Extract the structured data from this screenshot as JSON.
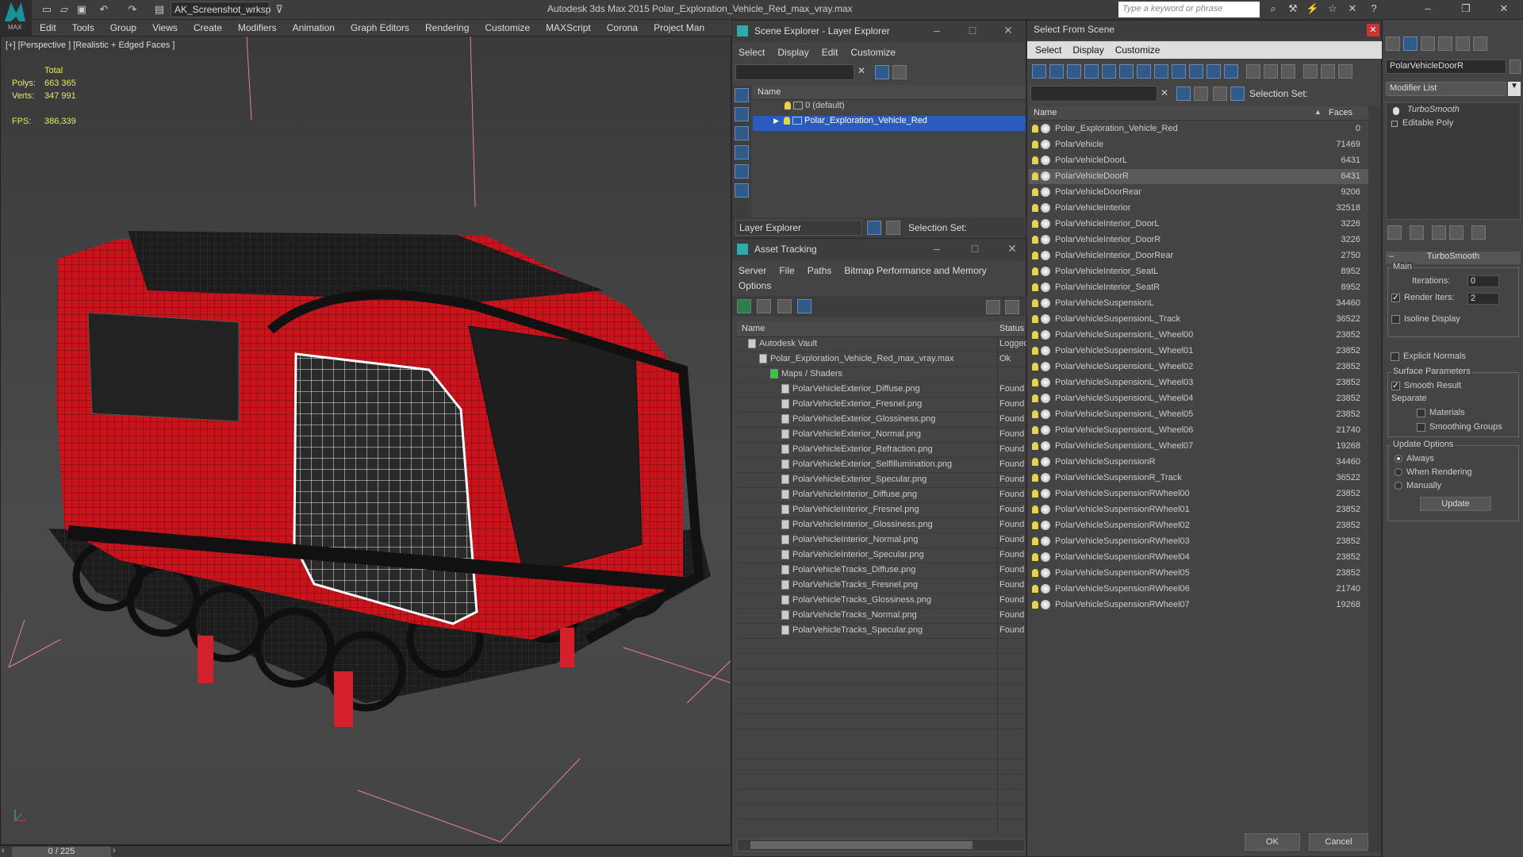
{
  "app": {
    "title": "Autodesk 3ds Max  2015    Polar_Exploration_Vehicle_Red_max_vray.max",
    "workspace": "AK_Screenshot_wrksp",
    "search_placeholder": "Type a keyword or phrase",
    "logo_text": "MAX"
  },
  "menubar": [
    "Edit",
    "Tools",
    "Group",
    "Views",
    "Create",
    "Modifiers",
    "Animation",
    "Graph Editors",
    "Rendering",
    "Customize",
    "MAXScript",
    "Corona",
    "Project Man"
  ],
  "viewport": {
    "label": "[+] [Perspective ] [Realistic + Edged Faces ]",
    "stats": {
      "total_label": "Total",
      "polys_label": "Polys:",
      "polys": "663 365",
      "verts_label": "Verts:",
      "verts": "347 991",
      "fps_label": "FPS:",
      "fps": "386,339"
    },
    "timeline": "0 / 225"
  },
  "scene_explorer": {
    "title": "Scene Explorer - Layer Explorer",
    "menu": [
      "Select",
      "Display",
      "Edit",
      "Customize"
    ],
    "col_name": "Name",
    "layers": [
      "0 (default)",
      "Polar_Exploration_Vehicle_Red"
    ],
    "footer_label": "Layer Explorer",
    "selection_set": "Selection Set:"
  },
  "asset_tracking": {
    "title": "Asset Tracking",
    "menu": [
      "Server",
      "File",
      "Paths",
      "Bitmap Performance and Memory"
    ],
    "menu2": "Options",
    "col_name": "Name",
    "col_status": "Status",
    "rows": [
      {
        "name": "Autodesk Vault",
        "status": "Logged",
        "indent": 1
      },
      {
        "name": "Polar_Exploration_Vehicle_Red_max_vray.max",
        "status": "Ok",
        "indent": 2
      },
      {
        "name": "Maps / Shaders",
        "status": "",
        "indent": 3
      },
      {
        "name": "PolarVehicleExterior_Diffuse.png",
        "status": "Found",
        "indent": 4
      },
      {
        "name": "PolarVehicleExterior_Fresnel.png",
        "status": "Found",
        "indent": 4
      },
      {
        "name": "PolarVehicleExterior_Glossiness.png",
        "status": "Found",
        "indent": 4
      },
      {
        "name": "PolarVehicleExterior_Normal.png",
        "status": "Found",
        "indent": 4
      },
      {
        "name": "PolarVehicleExterior_Refraction.png",
        "status": "Found",
        "indent": 4
      },
      {
        "name": "PolarVehicleExterior_SelfIllumination.png",
        "status": "Found",
        "indent": 4
      },
      {
        "name": "PolarVehicleExterior_Specular.png",
        "status": "Found",
        "indent": 4
      },
      {
        "name": "PolarVehicleInterior_Diffuse.png",
        "status": "Found",
        "indent": 4
      },
      {
        "name": "PolarVehicleInterior_Fresnel.png",
        "status": "Found",
        "indent": 4
      },
      {
        "name": "PolarVehicleInterior_Glossiness.png",
        "status": "Found",
        "indent": 4
      },
      {
        "name": "PolarVehicleInterior_Normal.png",
        "status": "Found",
        "indent": 4
      },
      {
        "name": "PolarVehicleInterior_Specular.png",
        "status": "Found",
        "indent": 4
      },
      {
        "name": "PolarVehicleTracks_Diffuse.png",
        "status": "Found",
        "indent": 4
      },
      {
        "name": "PolarVehicleTracks_Fresnel.png",
        "status": "Found",
        "indent": 4
      },
      {
        "name": "PolarVehicleTracks_Glossiness.png",
        "status": "Found",
        "indent": 4
      },
      {
        "name": "PolarVehicleTracks_Normal.png",
        "status": "Found",
        "indent": 4
      },
      {
        "name": "PolarVehicleTracks_Specular.png",
        "status": "Found",
        "indent": 4
      }
    ]
  },
  "select_from_scene": {
    "title": "Select From Scene",
    "menu": [
      "Select",
      "Display",
      "Customize"
    ],
    "selection_set": "Selection Set:",
    "col_name": "Name",
    "col_faces": "Faces",
    "ok": "OK",
    "cancel": "Cancel",
    "rows": [
      {
        "name": "Polar_Exploration_Vehicle_Red",
        "faces": "0"
      },
      {
        "name": "PolarVehicle",
        "faces": "71469"
      },
      {
        "name": "PolarVehicleDoorL",
        "faces": "6431"
      },
      {
        "name": "PolarVehicleDoorR",
        "faces": "6431"
      },
      {
        "name": "PolarVehicleDoorRear",
        "faces": "9206"
      },
      {
        "name": "PolarVehicleInterior",
        "faces": "32518"
      },
      {
        "name": "PolarVehicleInterior_DoorL",
        "faces": "3226"
      },
      {
        "name": "PolarVehicleInterior_DoorR",
        "faces": "3226"
      },
      {
        "name": "PolarVehicleInterior_DoorRear",
        "faces": "2750"
      },
      {
        "name": "PolarVehicleInterior_SeatL",
        "faces": "8952"
      },
      {
        "name": "PolarVehicleInterior_SeatR",
        "faces": "8952"
      },
      {
        "name": "PolarVehicleSuspensionL",
        "faces": "34460"
      },
      {
        "name": "PolarVehicleSuspensionL_Track",
        "faces": "36522"
      },
      {
        "name": "PolarVehicleSuspensionL_Wheel00",
        "faces": "23852"
      },
      {
        "name": "PolarVehicleSuspensionL_Wheel01",
        "faces": "23852"
      },
      {
        "name": "PolarVehicleSuspensionL_Wheel02",
        "faces": "23852"
      },
      {
        "name": "PolarVehicleSuspensionL_Wheel03",
        "faces": "23852"
      },
      {
        "name": "PolarVehicleSuspensionL_Wheel04",
        "faces": "23852"
      },
      {
        "name": "PolarVehicleSuspensionL_Wheel05",
        "faces": "23852"
      },
      {
        "name": "PolarVehicleSuspensionL_Wheel06",
        "faces": "21740"
      },
      {
        "name": "PolarVehicleSuspensionL_Wheel07",
        "faces": "19268"
      },
      {
        "name": "PolarVehicleSuspensionR",
        "faces": "34460"
      },
      {
        "name": "PolarVehicleSuspensionR_Track",
        "faces": "36522"
      },
      {
        "name": "PolarVehicleSuspensionRWheel00",
        "faces": "23852"
      },
      {
        "name": "PolarVehicleSuspensionRWheel01",
        "faces": "23852"
      },
      {
        "name": "PolarVehicleSuspensionRWheel02",
        "faces": "23852"
      },
      {
        "name": "PolarVehicleSuspensionRWheel03",
        "faces": "23852"
      },
      {
        "name": "PolarVehicleSuspensionRWheel04",
        "faces": "23852"
      },
      {
        "name": "PolarVehicleSuspensionRWheel05",
        "faces": "23852"
      },
      {
        "name": "PolarVehicleSuspensionRWheel06",
        "faces": "21740"
      },
      {
        "name": "PolarVehicleSuspensionRWheel07",
        "faces": "19268"
      }
    ]
  },
  "modify_panel": {
    "object_name": "PolarVehicleDoorR",
    "modifier_list": "Modifier List",
    "stack": [
      "TurboSmooth",
      "Editable Poly"
    ],
    "rollout": "TurboSmooth",
    "main": "Main",
    "iterations_label": "Iterations:",
    "iterations": "0",
    "render_iters_label": "Render Iters:",
    "render_iters": "2",
    "isoline": "Isoline Display",
    "explicit": "Explicit Normals",
    "surface_params": "Surface Parameters",
    "smooth_result": "Smooth Result",
    "separate": "Separate",
    "materials": "Materials",
    "smoothing_groups": "Smoothing Groups",
    "update_options": "Update Options",
    "always": "Always",
    "when_rendering": "When Rendering",
    "manually": "Manually",
    "update": "Update"
  },
  "colors": {
    "accent": "#2b5bbf",
    "selected_row": "#5a5a5a",
    "vehicle_red": "#c8141c"
  }
}
